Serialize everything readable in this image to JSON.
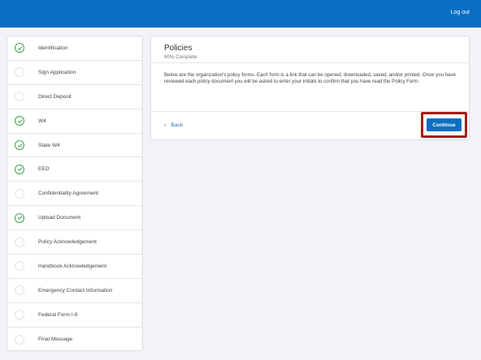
{
  "header": {
    "logout_label": "Log out",
    "accent_color": "#0a6fc2"
  },
  "sidebar": {
    "steps": [
      {
        "label": "Identification",
        "completed": true
      },
      {
        "label": "Sign Application",
        "completed": false
      },
      {
        "label": "Direct Deposit",
        "completed": false
      },
      {
        "label": "W4",
        "completed": true
      },
      {
        "label": "State W4",
        "completed": true
      },
      {
        "label": "EEO",
        "completed": true
      },
      {
        "label": "Confidentiality Agreement",
        "completed": false
      },
      {
        "label": "Upload Document",
        "completed": true
      },
      {
        "label": "Policy Acknowledgement",
        "completed": false
      },
      {
        "label": "Handbook Acknowledgement",
        "completed": false
      },
      {
        "label": "Emergency Contact Information",
        "completed": false
      },
      {
        "label": "Federal Form I-9",
        "completed": false
      },
      {
        "label": "Final Message",
        "completed": false
      }
    ],
    "completed_icon": "check-circle-icon",
    "pending_icon": "empty-circle-icon",
    "completed_color": "#3aa547"
  },
  "panel": {
    "title": "Policies",
    "progress_text": "60% Complete",
    "body_text": "Below are the organization's policy forms. Each form is a link that can be opened, downloaded, saved, and/or printed. Once you have reviewed each policy document you will be asked to enter your initials to confirm that you have read the Policy Form.",
    "back_label": "Back",
    "back_icon": "chevron-left-icon",
    "continue_label": "Continue"
  },
  "annotation": {
    "highlight_color": "#a31f15"
  }
}
